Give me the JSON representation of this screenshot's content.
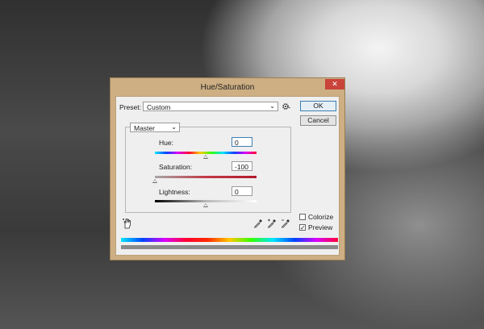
{
  "dialog": {
    "title": "Hue/Saturation",
    "close_glyph": "✕"
  },
  "preset": {
    "label": "Preset:",
    "value": "Custom",
    "settings_icon": "gear-icon"
  },
  "buttons": {
    "ok": "OK",
    "cancel": "Cancel"
  },
  "channel": {
    "value": "Master"
  },
  "hue": {
    "label": "Hue:",
    "value": "0",
    "slider_fraction": 0.5
  },
  "saturation": {
    "label": "Saturation:",
    "value": "-100",
    "slider_fraction": 0.0
  },
  "lightness": {
    "label": "Lightness:",
    "value": "0",
    "slider_fraction": 0.5
  },
  "options": {
    "colorize_label": "Colorize",
    "colorize_checked": false,
    "preview_label": "Preview",
    "preview_checked": true
  },
  "tools": {
    "adjust_icon": "hand-adjust-icon",
    "eyedroppers": [
      "eyedropper-icon",
      "eyedropper-plus-icon",
      "eyedropper-minus-icon"
    ]
  },
  "colors": {
    "accent": "#3c7fb1",
    "frame": "#cdaf83",
    "close": "#c9443b"
  }
}
